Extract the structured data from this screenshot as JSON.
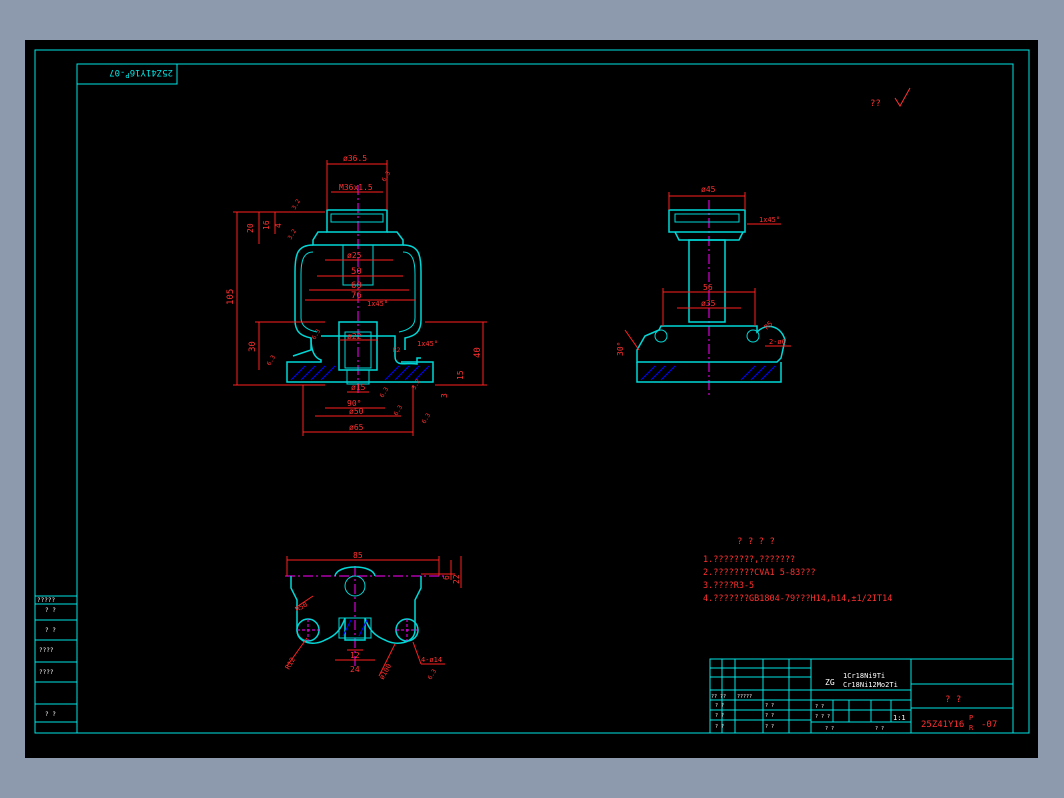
{
  "colors": {
    "frame": "#00e5e5",
    "dim": "#ff2020",
    "part": "#00d8d8",
    "center": "#ff00ff",
    "hatch": "#0000ff",
    "text": "#ff3030",
    "window": "#8d9aae"
  },
  "stamp_rotated": "25Z41Y16 P -07",
  "stamp_rotated_parts": {
    "code": "25Z41Y16",
    "sup": "P",
    "sub": "R",
    "suffix": "-07"
  },
  "roughness_note": "??",
  "front_view": {
    "dims": [
      "ø36.5",
      "M36x1.5",
      "20",
      "16",
      "4",
      "105",
      "ø25",
      "50",
      "60",
      "76",
      "1x45°",
      "ø22",
      "30",
      "1x45°",
      "40",
      "ø15",
      "90°",
      "ø50",
      "ø65",
      "15",
      "3",
      "3.2",
      "6.3",
      "3.2",
      "6.3",
      "3.2",
      "6.3",
      "6.3",
      "6.3",
      "R2",
      "6.3"
    ]
  },
  "side_view": {
    "dims": [
      "ø45",
      "1x45°",
      "56",
      "ø35",
      "R5",
      "30°",
      "2-ø6"
    ]
  },
  "bottom_view": {
    "dims": [
      "85",
      "6",
      "22",
      "R50",
      "12",
      "24",
      "R12",
      "ø100",
      "4-ø14",
      "6.3"
    ]
  },
  "notes": {
    "title": "? ? ? ?",
    "lines": [
      "1.????????,???????",
      "2.????????CVA1 5-83???",
      "3.????R3-5",
      "4.???????GB1804-79???H14,h14,±1/2IT14"
    ]
  },
  "title_block": {
    "material_prefix": "ZG",
    "material_line1": "1Cr18Ni9Ti",
    "material_line2": "Cr18Ni12Mo2Ti",
    "name": "?   ?",
    "scale": "1:1",
    "drawing_no": {
      "code": "25Z41Y16",
      "sup": "P",
      "sub": "R",
      "suffix": "-07"
    },
    "row_labels": [
      "?? ??",
      "?????",
      "? ?",
      "? ?",
      "? ?",
      "? ?",
      "? ?",
      "? ?",
      "? ?",
      "? ? ?",
      "? ?",
      "? ?"
    ]
  },
  "side_table": {
    "items": [
      "?????",
      "? ?",
      "? ?",
      "????",
      "????",
      "? ?"
    ]
  }
}
